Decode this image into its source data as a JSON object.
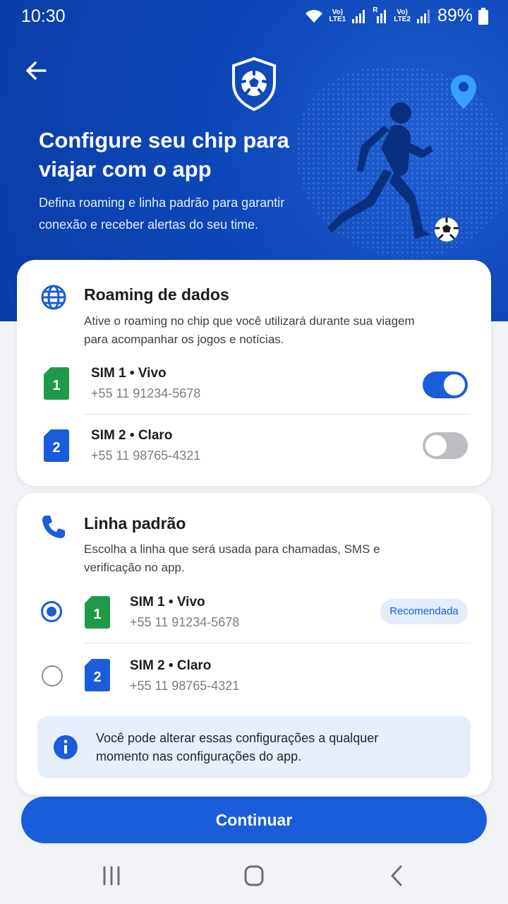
{
  "status_bar": {
    "time": "10:30",
    "battery_percent": "89%",
    "network1_top": "Vo)",
    "network1_bottom": "LTE1",
    "network2_top": "Vo)",
    "network2_bottom": "LTE2",
    "roaming_letter": "R"
  },
  "hero": {
    "title": "Configure seu chip para viajar com o app",
    "subtitle": "Defina roaming e linha padrão para garantir conexão e receber alertas do seu time."
  },
  "roaming": {
    "title": "Roaming de dados",
    "description": "Ative o roaming no chip que você utilizará durante sua viagem para acompanhar os jogos e notícias.",
    "sims": [
      {
        "badge": "1",
        "name": "SIM 1 • Vivo",
        "number": "+55 11 91234-5678",
        "enabled": true
      },
      {
        "badge": "2",
        "name": "SIM 2 • Claro",
        "number": "+55 11 98765-4321",
        "enabled": false
      }
    ]
  },
  "linha": {
    "title": "Linha padrão",
    "description": "Escolha a linha que será usada para chamadas, SMS e verificação no app.",
    "sims": [
      {
        "badge": "1",
        "name": "SIM 1 • Vivo",
        "number": "+55 11 91234-5678",
        "selected": true,
        "tag": "Recomendada"
      },
      {
        "badge": "2",
        "name": "SIM 2 • Claro",
        "number": "+55 11 98765-4321",
        "selected": false
      }
    ],
    "info": "Você pode alterar essas configurações a qualquer momento nas configurações do app."
  },
  "actions": {
    "continue_label": "Continuar"
  },
  "colors": {
    "primary": "#1a5ddb",
    "hero_bg": "#0d47b8",
    "sim1_green": "#1f9a48",
    "sim2_blue": "#1a5ddb",
    "toggle_off": "#bcbdc2"
  },
  "icons": {
    "back": "arrow-left-icon",
    "logo": "shield-soccer-ball-icon",
    "roaming": "globe-icon",
    "linha": "phone-icon",
    "info": "info-icon",
    "nav_recents": "recents-icon",
    "nav_home": "home-icon",
    "nav_back": "chevron-left-icon"
  }
}
